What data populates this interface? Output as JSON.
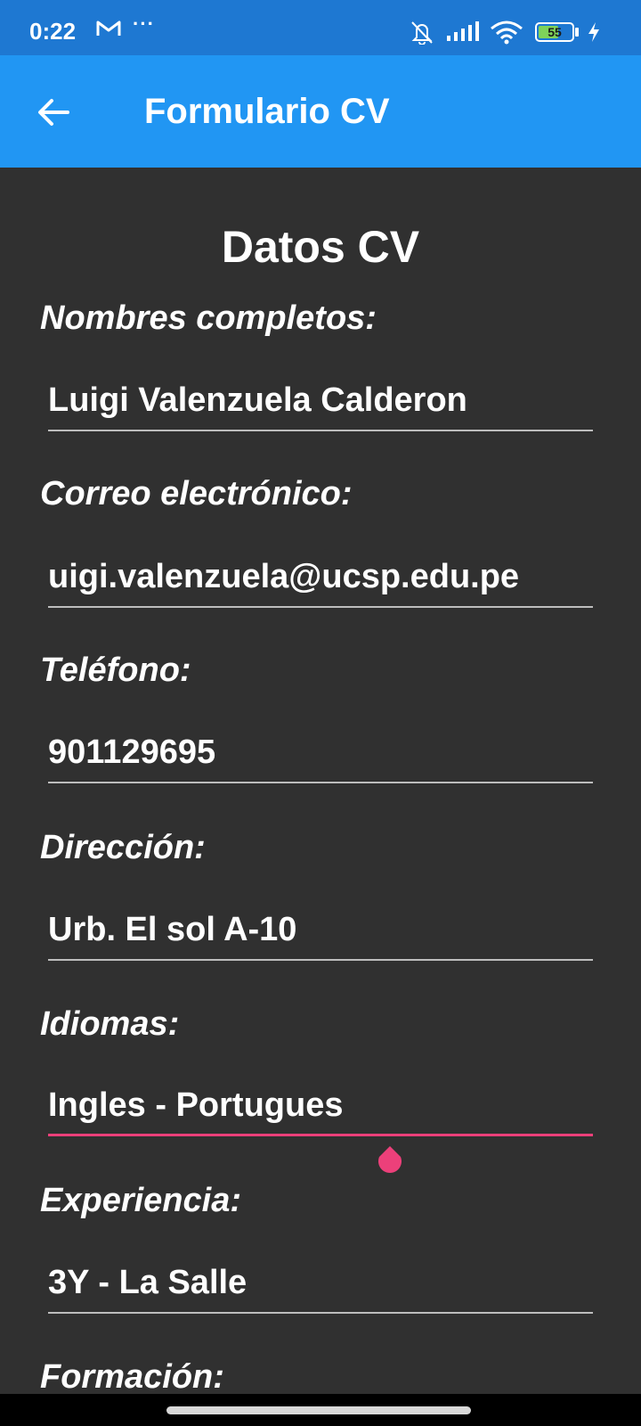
{
  "status_bar": {
    "time": "0:22",
    "battery_level": "55",
    "icons": [
      "gmail-icon",
      "more-dots-icon",
      "bell-muted-icon",
      "signal-icon",
      "wifi-icon",
      "battery-icon",
      "charging-bolt-icon"
    ]
  },
  "app_bar": {
    "title": "Formulario CV",
    "back_icon": "arrow-left-icon"
  },
  "form": {
    "section_title": "Datos CV",
    "fields": [
      {
        "label": "Nombres completos:",
        "value": "Luigi Valenzuela Calderon"
      },
      {
        "label": "Correo electrónico:",
        "value": "uigi.valenzuela@ucsp.edu.pe"
      },
      {
        "label": "Teléfono:",
        "value": "901129695"
      },
      {
        "label": "Dirección:",
        "value": "Urb. El sol A-10"
      },
      {
        "label": "Idiomas:",
        "value": "Ingles - Portugues"
      },
      {
        "label": "Experiencia:",
        "value": "3Y - La Salle"
      },
      {
        "label": "Formación:",
        "value": ""
      }
    ]
  },
  "colors": {
    "status_bar": "#1e78d2",
    "app_bar": "#2196f3",
    "background": "#303030",
    "focus_accent": "#ec407a",
    "underline": "#bdbdbd"
  }
}
